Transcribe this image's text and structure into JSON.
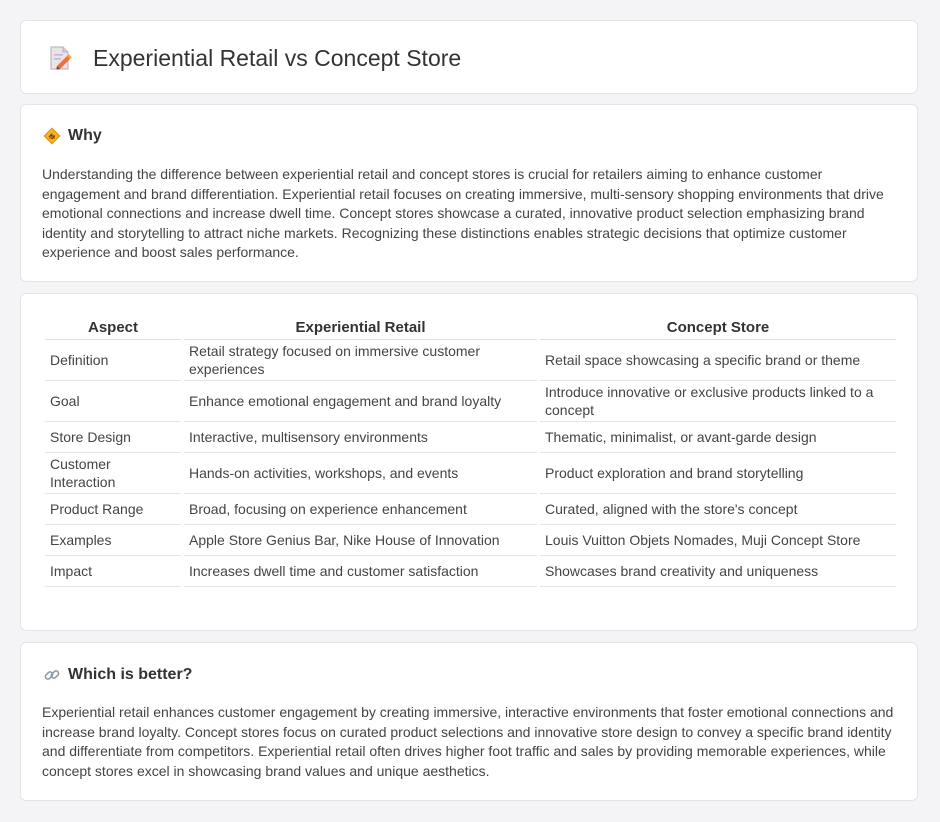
{
  "page": {
    "title": "Experiential Retail vs Concept Store",
    "title_icon": "document-pencil-icon"
  },
  "why": {
    "heading": "Why",
    "icon": "diamond-sign-icon",
    "text": "Understanding the difference between experiential retail and concept stores is crucial for retailers aiming to enhance customer engagement and brand differentiation. Experiential retail focuses on creating immersive, multi-sensory shopping environments that drive emotional connections and increase dwell time. Concept stores showcase a curated, innovative product selection emphasizing brand identity and storytelling to attract niche markets. Recognizing these distinctions enables strategic decisions that optimize customer experience and boost sales performance."
  },
  "table": {
    "headers": [
      "Aspect",
      "Experiential Retail",
      "Concept Store"
    ],
    "rows": [
      [
        "Definition",
        "Retail strategy focused on immersive customer experiences",
        "Retail space showcasing a specific brand or theme"
      ],
      [
        "Goal",
        "Enhance emotional engagement and brand loyalty",
        "Introduce innovative or exclusive products linked to a concept"
      ],
      [
        "Store Design",
        "Interactive, multisensory environments",
        "Thematic, minimalist, or avant-garde design"
      ],
      [
        "Customer Interaction",
        "Hands-on activities, workshops, and events",
        "Product exploration and brand storytelling"
      ],
      [
        "Product Range",
        "Broad, focusing on experience enhancement",
        "Curated, aligned with the store's concept"
      ],
      [
        "Examples",
        "Apple Store Genius Bar, Nike House of Innovation",
        "Louis Vuitton Objets Nomades, Muji Concept Store"
      ],
      [
        "Impact",
        "Increases dwell time and customer satisfaction",
        "Showcases brand creativity and uniqueness"
      ]
    ]
  },
  "better": {
    "heading": "Which is better?",
    "icon": "link-icon",
    "text": "Experiential retail enhances customer engagement by creating immersive, interactive environments that foster emotional connections and increase brand loyalty. Concept stores focus on curated product selections and innovative store design to convey a specific brand identity and differentiate from competitors. Experiential retail often drives higher foot traffic and sales by providing memorable experiences, while concept stores excel in showcasing brand values and unique aesthetics."
  }
}
